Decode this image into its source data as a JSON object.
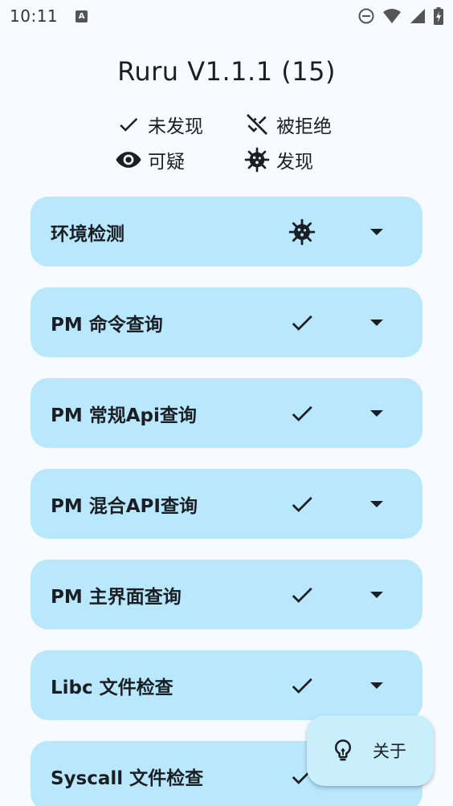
{
  "status_bar": {
    "time": "10:11",
    "app_icon_letter": "A",
    "icons": [
      "app-notification-icon",
      "dnd-icon",
      "wifi-icon",
      "cell-signal-icon",
      "battery-charging-icon"
    ]
  },
  "title": "Ruru V1.1.1 (15)",
  "legend": {
    "not_found": "未发现",
    "denied": "被拒绝",
    "suspicious": "可疑",
    "found": "发现"
  },
  "checks": [
    {
      "label": "环境检测",
      "status": "found"
    },
    {
      "label": "PM 命令查询",
      "status": "not_found"
    },
    {
      "label": "PM 常规Api查询",
      "status": "not_found"
    },
    {
      "label": "PM 混合API查询",
      "status": "not_found"
    },
    {
      "label": "PM 主界面查询",
      "status": "not_found"
    },
    {
      "label": "Libc 文件检查",
      "status": "not_found"
    },
    {
      "label": "Syscall 文件检查",
      "status": "not_found"
    }
  ],
  "fab": {
    "label": "关于",
    "icon": "lightbulb-icon"
  },
  "colors": {
    "background": "#f7fbff",
    "card": "#b9e8fd",
    "fab": "#c9eefc",
    "text": "#1b1f24"
  }
}
